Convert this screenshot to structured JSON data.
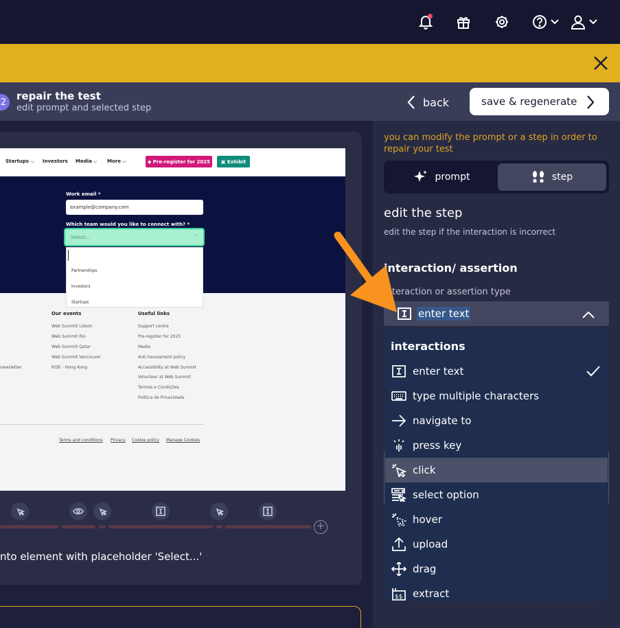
{
  "topbar": {
    "icons": [
      "bell-icon",
      "gift-icon",
      "gear-icon",
      "help-icon",
      "user-icon"
    ]
  },
  "repair": {
    "step_number": "2",
    "title": "repair the test",
    "subtitle": "edit prompt and selected step",
    "back_label": "back",
    "save_label": "save & regenerate"
  },
  "screenshot": {
    "nav": [
      "Startups",
      "Investors",
      "Media",
      "More"
    ],
    "prereg_label": "Pre-register for 2025",
    "exhibit_label": "Exhibit",
    "email_label": "Work email *",
    "email_value": "example@company.com",
    "team_label": "Which team would you like to connect with? *",
    "select_placeholder": "Select...",
    "options": [
      "Partnerships",
      "Investors",
      "Startups"
    ],
    "events_heading": "Our events",
    "events": [
      "Web Summit Lisbon",
      "Web Summit Rio",
      "Web Summit Qatar",
      "Web Summit Vancouver",
      "RISE - Hong Kong"
    ],
    "useful_heading": "Useful links",
    "useful": [
      "Support centre",
      "Pre-register for 2025",
      "Media",
      "Anti-harassment policy",
      "Accessibility at Web Summit",
      "Volunteer at Web Summit",
      "Termos e Condições",
      "Política de Privacidade"
    ],
    "newsletter": "newsletter",
    "legal": [
      "Terms and conditions",
      "Privacy",
      "Cookie policy",
      "Manage Cookies"
    ]
  },
  "step_description": "nto element with placeholder 'Select...'",
  "panel": {
    "hint": "you can modify the prompt or a step in order to repair your test",
    "tab_prompt": "prompt",
    "tab_step": "step",
    "edit_title": "edit the step",
    "edit_sub": "edit the step if the interaction is incorrect",
    "ia_title": "interaction/ assertion",
    "ia_label": "interaction or assertion type",
    "selected_type": "enter text"
  },
  "menu": {
    "heading": "interactions",
    "items": [
      {
        "label": "enter text",
        "icon": "text-cursor-icon"
      },
      {
        "label": "type multiple characters",
        "icon": "keyboard-icon"
      },
      {
        "label": "navigate to",
        "icon": "arrow-right-icon"
      },
      {
        "label": "press key",
        "icon": "key-press-icon"
      },
      {
        "label": "click",
        "icon": "cursor-click-icon"
      },
      {
        "label": "select option",
        "icon": "select-option-icon"
      },
      {
        "label": "hover",
        "icon": "hover-icon"
      },
      {
        "label": "upload",
        "icon": "upload-icon"
      },
      {
        "label": "drag",
        "icon": "drag-icon"
      },
      {
        "label": "extract",
        "icon": "extract-icon"
      }
    ],
    "selected": "enter text",
    "highlighted": "click"
  },
  "colors": {
    "banner": "#e2b01f",
    "accent_orange": "#f7931e",
    "hint_text": "#e0a324",
    "menu_bg": "#1f2e4e"
  }
}
